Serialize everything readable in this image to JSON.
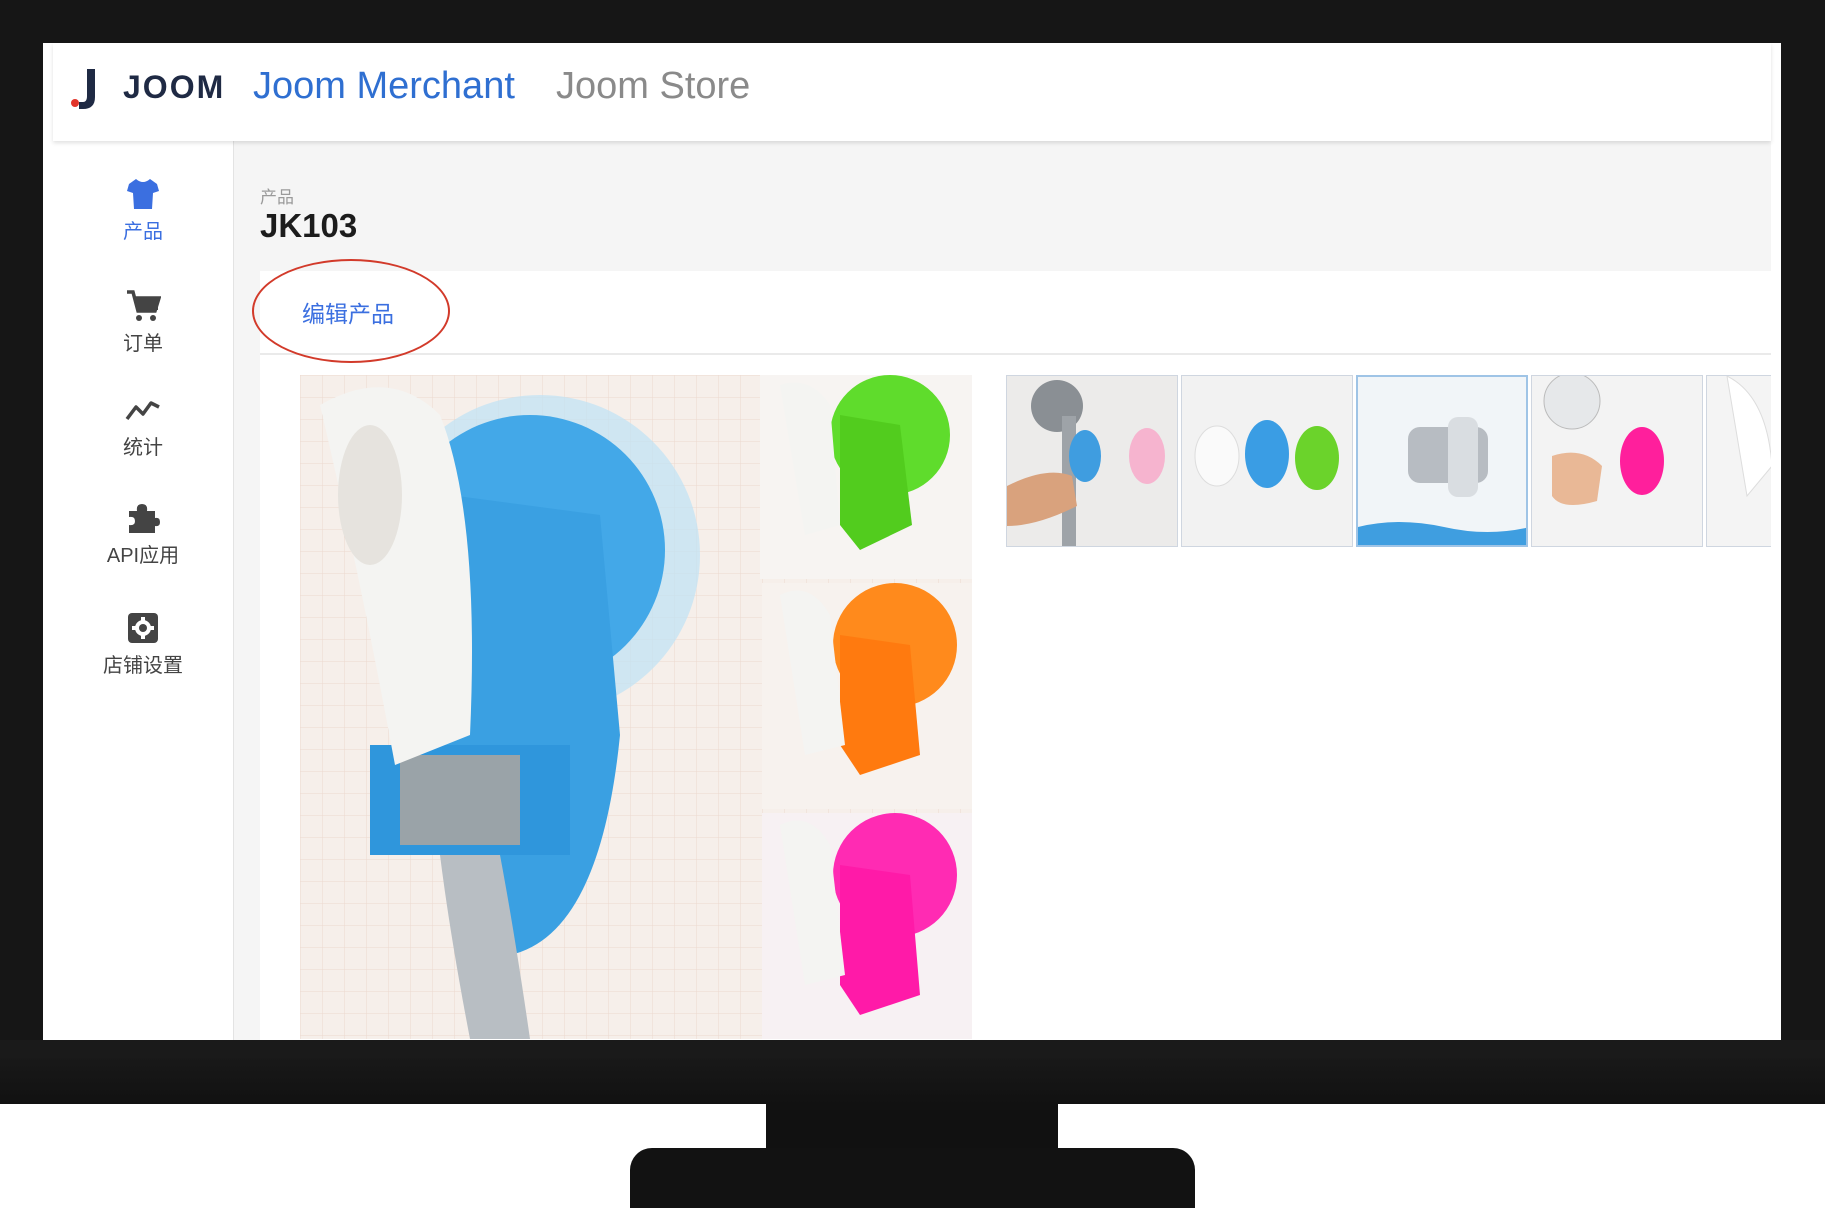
{
  "header": {
    "logo_text": "JOOM",
    "brand_title": "Joom Merchant",
    "store_name": "Joom Store",
    "accent_color": "#2f6fd1"
  },
  "sidebar": {
    "items": [
      {
        "label": "产品",
        "icon": "tshirt-icon",
        "active": true
      },
      {
        "label": "订单",
        "icon": "cart-icon",
        "active": false
      },
      {
        "label": "统计",
        "icon": "chart-line-icon",
        "active": false
      },
      {
        "label": "API应用",
        "icon": "puzzle-icon",
        "active": false
      },
      {
        "label": "店铺设置",
        "icon": "gear-icon",
        "active": false
      }
    ]
  },
  "page": {
    "breadcrumb": "产品",
    "title": "JK103",
    "edit_tab_label": "编辑产品",
    "highlight_color": "#d23a2a"
  },
  "gallery": {
    "main_image": "product-main-image",
    "thumbnails": [
      "thumbnail-hand-holding-showerhead",
      "thumbnail-three-colors",
      "thumbnail-chrome-holder",
      "thumbnail-pink-holder",
      "thumbnail-white-partial"
    ]
  }
}
